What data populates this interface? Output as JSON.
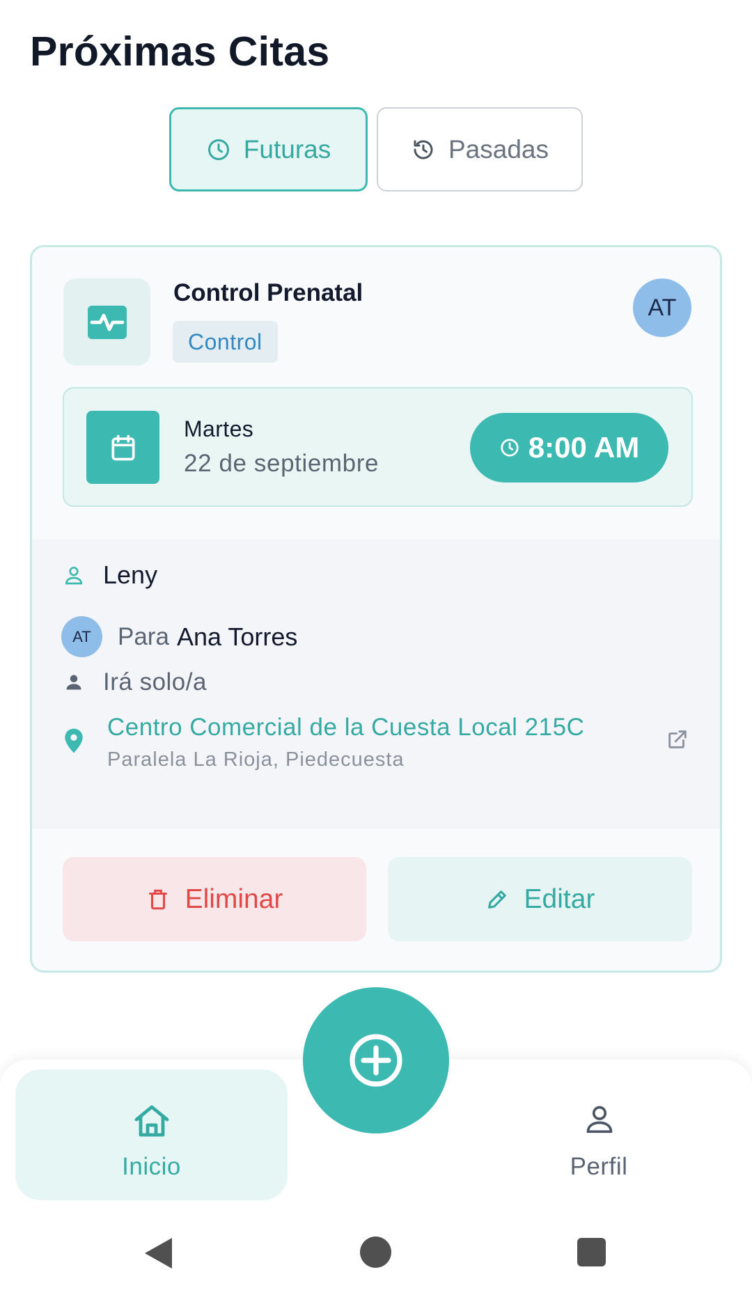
{
  "page": {
    "title": "Próximas Citas"
  },
  "tabs": [
    {
      "label": "Futuras",
      "icon": "clock-icon",
      "active": true
    },
    {
      "label": "Pasadas",
      "icon": "history-icon",
      "active": false
    }
  ],
  "appointment": {
    "type_icon": "heart-monitor-icon",
    "title": "Control Prenatal",
    "tag": "Control",
    "patient_initials": "AT",
    "day": "Martes",
    "date": "22 de septiembre",
    "time": "8:00 AM",
    "doctor": "Leny",
    "for_prefix": "Para",
    "patient_name": "Ana Torres",
    "companion": "Irá solo/a",
    "location_name": "Centro Comercial de la Cuesta Local 215C",
    "location_address": "Paralela La Rioja, Piedecuesta",
    "actions": {
      "delete_label": "Eliminar",
      "edit_label": "Editar"
    }
  },
  "bottom_nav": {
    "items": [
      {
        "label": "Inicio",
        "icon": "home-icon",
        "active": true
      },
      {
        "label": "Perfil",
        "icon": "user-icon",
        "active": false
      }
    ],
    "fab_icon": "plus-circle-icon"
  },
  "colors": {
    "accent": "#3cb9b1",
    "accent_text": "#35aaa3",
    "delete": "#e24848",
    "avatar": "#8fbde9",
    "tag_text": "#3389c0"
  }
}
